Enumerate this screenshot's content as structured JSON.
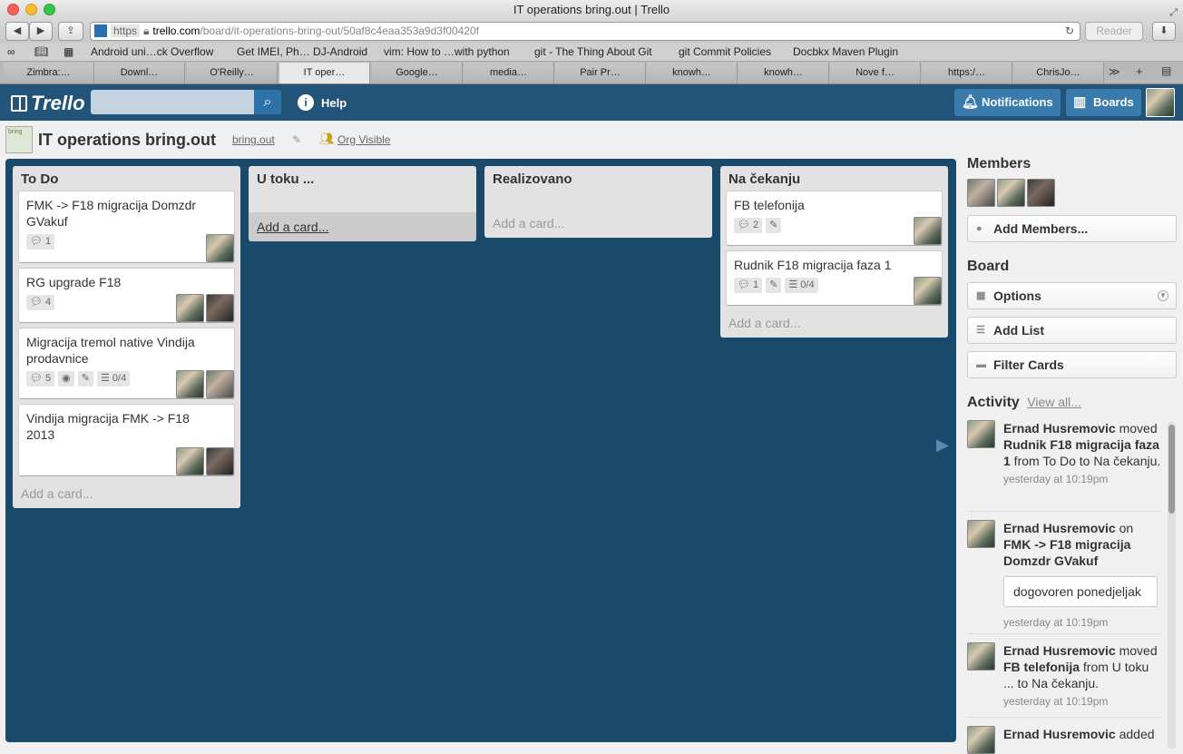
{
  "window": {
    "title": "IT operations bring.out | Trello"
  },
  "browser": {
    "url_scheme": "https",
    "url_host": "trello.com",
    "url_path": "/board/it-operations-bring-out/50af8c4eaa353a9d3f00420f",
    "reader_label": "Reader",
    "bookmarks": [
      "Android uni…ck Overflow",
      "Get IMEI, Ph… DJ-Android",
      "vim: How to …with python",
      "git - The Thing About Git",
      "git Commit Policies",
      "Docbkx Maven Plugin"
    ],
    "tabs": [
      "Zimbra:…",
      "Downl…",
      "O'Reilly…",
      "IT oper…",
      "Google…",
      "media…",
      "Pair Pr…",
      "knowh…",
      "knowh…",
      "Nove f…",
      "https:/…",
      "ChrisJo…"
    ],
    "active_tab": 3
  },
  "header": {
    "logo": "Trello",
    "search_value": "",
    "help_label": "Help",
    "notifications_label": "Notifications",
    "boards_label": "Boards"
  },
  "board": {
    "title": "IT operations bring.out",
    "org": "bring.out",
    "visibility": "Org Visible",
    "logo_text": "bring"
  },
  "lists": [
    {
      "title": "To Do",
      "add_label": "Add a card...",
      "cards": [
        {
          "title": "FMK -> F18 migracija Domzdr GVakuf",
          "comments": "1"
        },
        {
          "title": "RG upgrade F18",
          "comments": "4"
        },
        {
          "title": "Migracija tremol native Vindija prodavnice",
          "comments": "5",
          "checklist": "0/4"
        },
        {
          "title": "Vindija migracija FMK -> F18 2013"
        }
      ]
    },
    {
      "title": "U toku ...",
      "add_label": "Add a card...",
      "cards": []
    },
    {
      "title": "Realizovano",
      "add_label": "Add a card...",
      "cards": []
    },
    {
      "title": "Na čekanju",
      "add_label": "Add a card...",
      "cards": [
        {
          "title": "FB telefonija",
          "comments": "2"
        },
        {
          "title": "Rudnik F18 migracija faza 1",
          "comments": "1",
          "checklist": "0/4"
        }
      ]
    }
  ],
  "sidebar": {
    "members_title": "Members",
    "add_members_label": "Add Members...",
    "board_title": "Board",
    "options_label": "Options",
    "add_list_label": "Add List",
    "filter_cards_label": "Filter Cards",
    "activity_title": "Activity",
    "view_all_label": "View all...",
    "activity": [
      {
        "user": "Ernad Husremovic",
        "verb": " moved ",
        "target": "Rudnik F18 migracija faza 1",
        "rest": " from To Do to Na čekanju.",
        "time": "yesterday at 10:19pm"
      },
      {
        "user": "Ernad Husremovic",
        "verb": " on ",
        "target": "FMK -> F18 migracija Domzdr GVakuf",
        "comment": "dogovoren ponedjeljak",
        "time": "yesterday at 10:19pm"
      },
      {
        "user": "Ernad Husremovic",
        "verb": " moved ",
        "target": "FB telefonija",
        "rest": " from U toku ... to Na čekanju.",
        "time": "yesterday at 10:19pm"
      },
      {
        "user": "Ernad Husremovic",
        "verb": " added"
      }
    ]
  },
  "colors": {
    "header": "#215478",
    "board_bg": "#1a4a6b",
    "list_bg": "#e2e2e2"
  }
}
